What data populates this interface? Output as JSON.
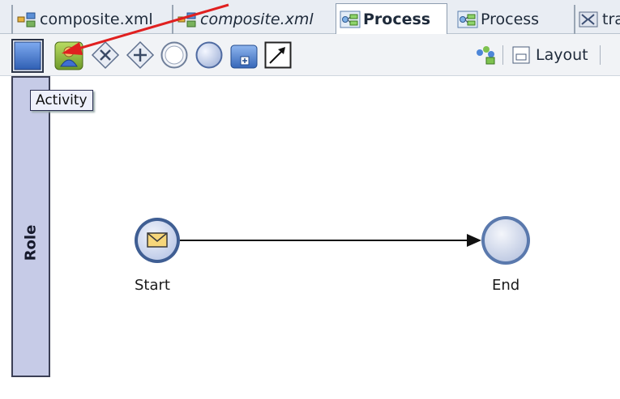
{
  "tabs": [
    {
      "label": "composite.xml",
      "style": "normal",
      "icon": "composite-icon"
    },
    {
      "label": "composite.xml",
      "style": "italic",
      "icon": "composite-icon"
    },
    {
      "label": "Process",
      "style": "bold-active",
      "icon": "process-icon"
    },
    {
      "label": "Process",
      "style": "normal",
      "icon": "process-icon"
    },
    {
      "label": "tra",
      "style": "normal",
      "icon": "transformation-icon"
    }
  ],
  "palette": {
    "tools": [
      "swimlane-tool-icon",
      "activity-tool-icon",
      "exclusive-gateway-icon",
      "parallel-gateway-icon",
      "start-event-icon",
      "end-event-icon",
      "subprocess-icon",
      "connector-tool-icon"
    ],
    "tooltip": "Activity"
  },
  "toolbar_right": {
    "layout_label": "Layout"
  },
  "lane": {
    "label": "Role"
  },
  "diagram": {
    "start_label": "Start",
    "end_label": "End"
  },
  "colors": {
    "arrow": "#e02020",
    "event_fill": "#c9d3ee",
    "event_border": "#3f5e93",
    "lane_fill": "#c6cbe7"
  }
}
